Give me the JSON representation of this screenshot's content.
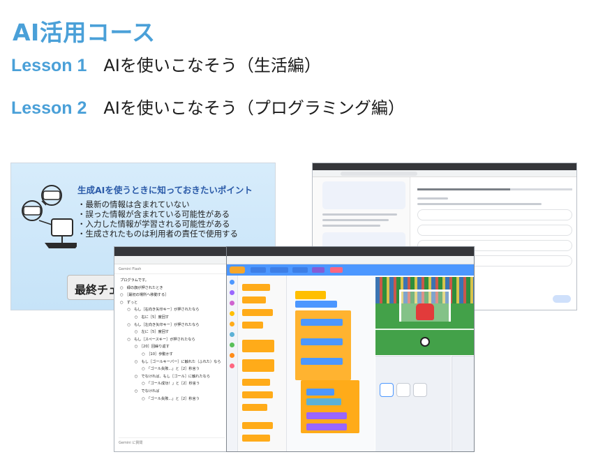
{
  "title": "AI活用コース",
  "lessons": [
    {
      "number": "Lesson 1",
      "text": "AIを使いこなそう（生活編）"
    },
    {
      "number": "Lesson 2",
      "text": "AIを使いこなそう（プログラミング編）"
    }
  ],
  "slide": {
    "logo_icon": "ai-robot-icon",
    "heading": "生成AIを使うときに知っておきたいポイント",
    "points": [
      "最新の情報は含まれていない",
      "誤った情報が含まれている可能性がある",
      "入力した情報が学習される可能性がある",
      "生成されたものは利用者の責任で使用する"
    ],
    "chip": "最終チェ"
  },
  "gemini": {
    "header": "Gemini Flash",
    "lines": [
      "プログラムです。",
      "○　緑の旗が押されたとき",
      "○　［最初の場所へ移動する］",
      "○　ずっと",
      "　　○　もし［右向き矢印キー］が押されたなら",
      "　　　　○　右に［5］度回す",
      "　　○　もし［左向き矢印キー］が押されたなら",
      "　　　　○　左に［5］度回す",
      "　　○　もし［スペースキー］が押されたなら",
      "　　　　○　［20］回繰り返す",
      "　　　　　　○　［10］歩動かす",
      "　　　　○　もし［ゴールキーパー］に触れた（ふれた）なら",
      "　　　　　　○　「ゴール失敗...」と［2］秒言う",
      "　　　　○　でなければ、もし［ゴール］に触れたなら",
      "　　　　　　○　「ゴール成功！」と［2］秒言う",
      "　　　　○　でなければ",
      "　　　　　　○　「ゴール失敗...」と［2］秒言う"
    ],
    "input_placeholder": "Gemini に質問"
  },
  "colors": {
    "accent": "#4aa0d8",
    "scratch_blue": "#4c97ff",
    "scratch_orange": "#ffab19"
  }
}
